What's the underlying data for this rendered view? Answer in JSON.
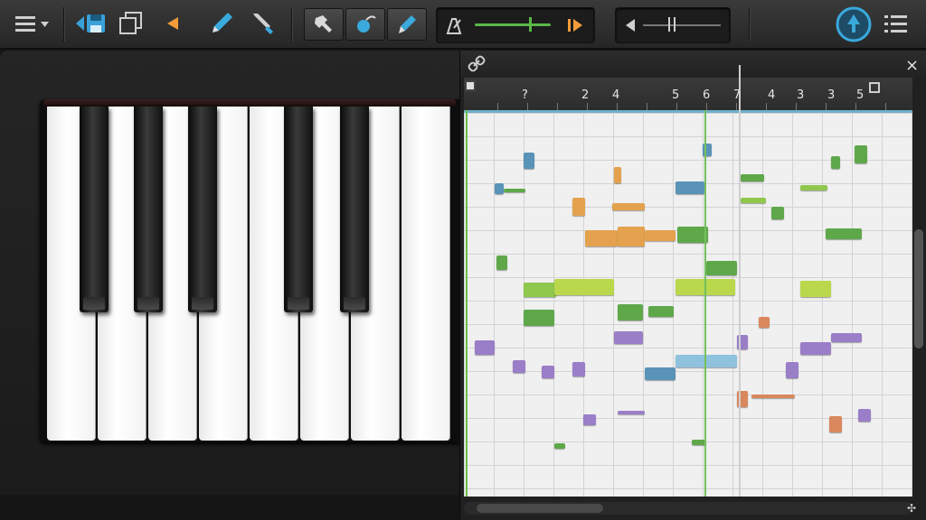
{
  "toolbar": {
    "icons": [
      "menu-icon",
      "save-icon",
      "duplicate-icon",
      "back-arrow-icon",
      "pen-icon",
      "brush-icon",
      "hammer-icon",
      "bend-icon",
      "marker-icon",
      "metronome-icon",
      "play-end-icon",
      "volume-icon",
      "record-up-icon",
      "list-icon"
    ],
    "accent_color": "#f39c3a",
    "highlight_color": "#3aa9dc"
  },
  "piano_roll": {
    "ruler_labels": [
      "?",
      "2",
      "4",
      "5",
      "6",
      "7",
      "4",
      "3",
      "3",
      "5"
    ],
    "close_label": "×",
    "colors": {
      "orange": "#e4a24e",
      "green": "#8fc84d",
      "lime": "#b9d84c",
      "blue": "#5a93b8",
      "purple": "#9a7ec8",
      "darkgreen": "#5ea84a",
      "salmon": "#d9875c",
      "lightblue": "#8ec2de"
    }
  }
}
